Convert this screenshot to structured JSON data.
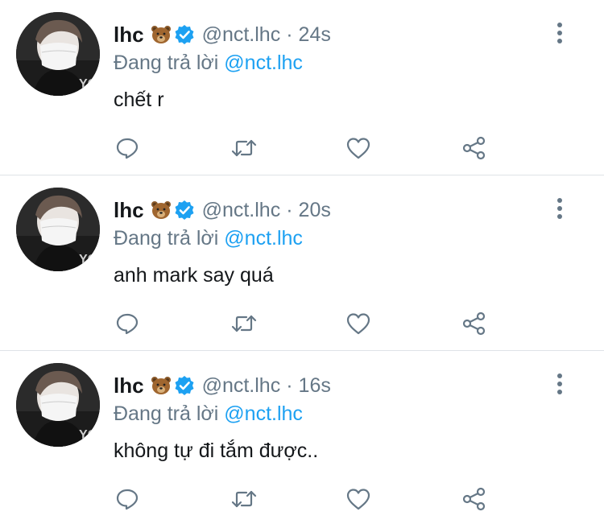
{
  "colors": {
    "link": "#1da1f2",
    "secondary_text": "#657786",
    "primary_text": "#14171a",
    "verified_badge": "#1da1f2",
    "divider": "#dfe3e7"
  },
  "tweets": [
    {
      "author_name": "lhc",
      "emoji_icon": "bear-face-icon",
      "verified_icon": "verified-badge-icon",
      "handle": "@nct.lhc",
      "separator": "·",
      "time": "24s",
      "reply_prefix": "Đang trả lời",
      "reply_to": "@nct.lhc",
      "text": "chết r"
    },
    {
      "author_name": "lhc",
      "emoji_icon": "bear-face-icon",
      "verified_icon": "verified-badge-icon",
      "handle": "@nct.lhc",
      "separator": "·",
      "time": "20s",
      "reply_prefix": "Đang trả lời",
      "reply_to": "@nct.lhc",
      "text": "anh mark say quá"
    },
    {
      "author_name": "lhc",
      "emoji_icon": "bear-face-icon",
      "verified_icon": "verified-badge-icon",
      "handle": "@nct.lhc",
      "separator": "·",
      "time": "16s",
      "reply_prefix": "Đang trả lời",
      "reply_to": "@nct.lhc",
      "text": "không tự đi tắm được.."
    }
  ],
  "action_icons": [
    "reply-icon",
    "retweet-icon",
    "like-icon",
    "share-icon"
  ],
  "menu_icon": "more-vertical-icon"
}
